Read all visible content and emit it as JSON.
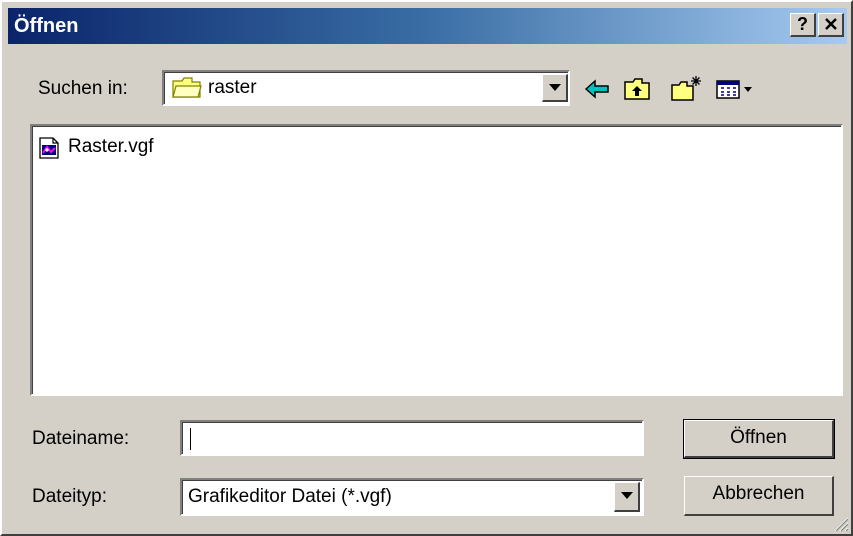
{
  "window": {
    "title": "Öffnen",
    "help_label": "?"
  },
  "toolbar": {
    "look_in_label": "Suchen in:",
    "look_in_value": "raster",
    "icons": [
      "folder-icon",
      "back-arrow-icon",
      "up-folder-icon",
      "new-folder-icon",
      "view-menu-icon"
    ]
  },
  "files": [
    {
      "name": "Raster.vgf",
      "icon": "vgf-file-icon"
    }
  ],
  "form": {
    "filename_label": "Dateiname:",
    "filename_value": "",
    "filetype_label": "Dateityp:",
    "filetype_value": "Grafikeditor Datei (*.vgf)"
  },
  "buttons": {
    "open_label": "Öffnen",
    "cancel_label": "Abbrechen"
  },
  "colors": {
    "titlebar_start": "#0a246a",
    "titlebar_end": "#a6caf0",
    "face": "#d4d0c8",
    "arrow_cyan": "#00c0c0",
    "folder_yellow": "#ffff80"
  }
}
